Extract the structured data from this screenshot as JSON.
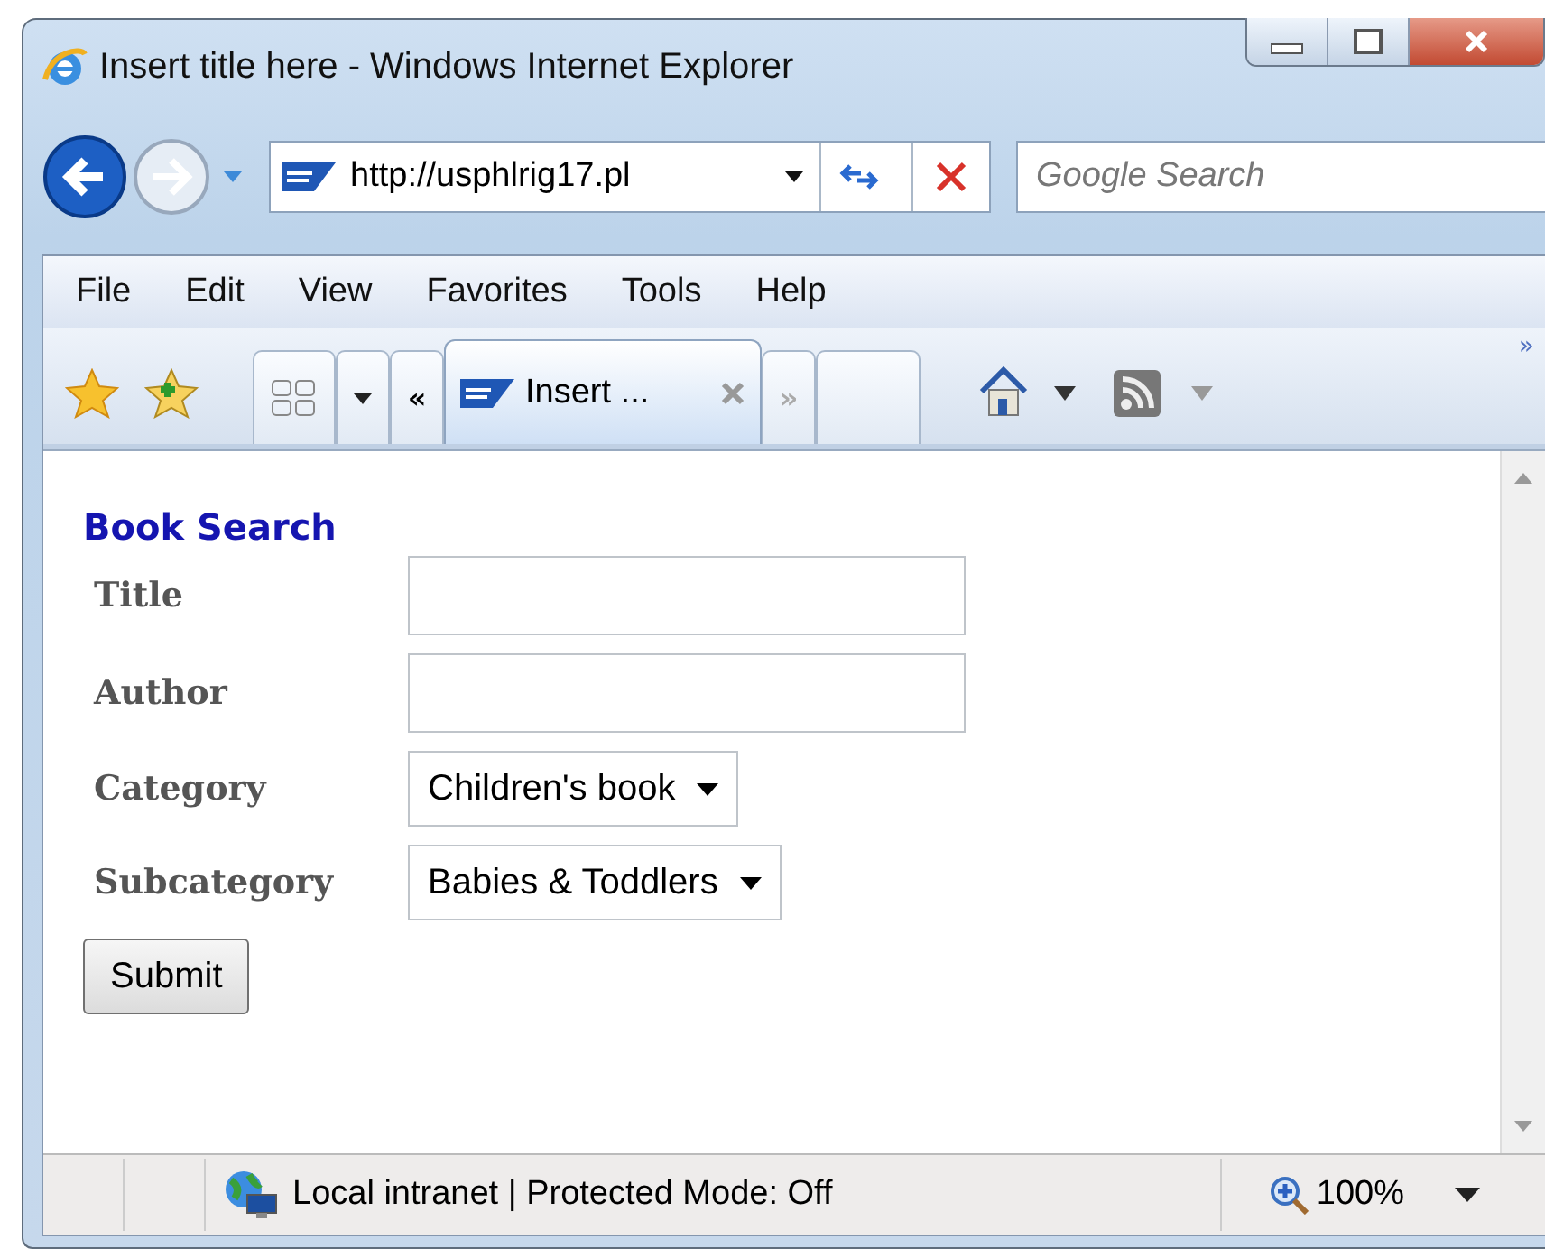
{
  "window": {
    "title": "Insert title here - Windows Internet Explorer"
  },
  "address_bar": {
    "value": "http://usphlrig17.pl"
  },
  "search": {
    "placeholder": "Google Search"
  },
  "menu": [
    "File",
    "Edit",
    "View",
    "Favorites",
    "Tools",
    "Help"
  ],
  "tab_row": {
    "scroll_back": "«",
    "scroll_forward": "»",
    "more": "»"
  },
  "tabs": [
    {
      "label": "Insert ...",
      "selected": true
    }
  ],
  "page": {
    "heading": "Book Search",
    "fields": [
      {
        "kind": "text",
        "label": "Title"
      },
      {
        "kind": "text",
        "label": "Author"
      },
      {
        "kind": "select",
        "label": "Category",
        "value": "Children's book"
      },
      {
        "kind": "select",
        "label": "Subcategory",
        "value": "Babies & Toddlers"
      }
    ],
    "submit": "Submit"
  },
  "status_bar": {
    "zone": "Local intranet | Protected Mode: Off",
    "zoom": "100%"
  }
}
